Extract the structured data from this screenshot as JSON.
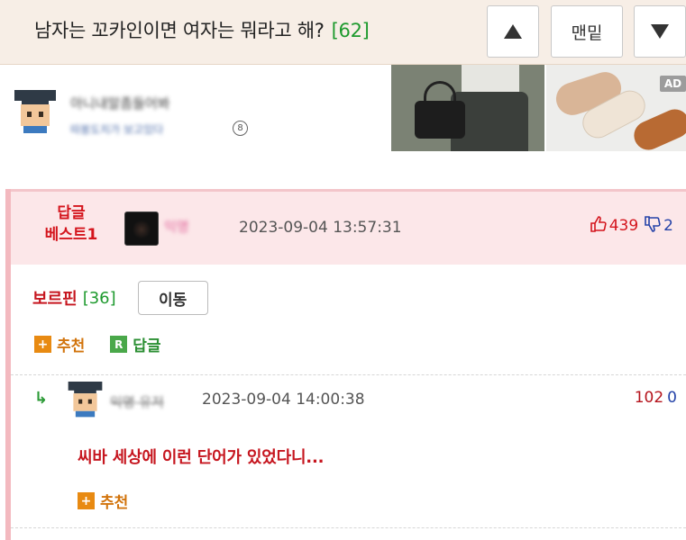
{
  "topbar": {
    "title": "남자는 꼬카인이면 여자는 뭐라고 해?",
    "comment_count": "[62]",
    "bottom_label": "맨밑"
  },
  "author": {
    "name_blurred": "아니내말좀들어봐",
    "sub_blurred": "따봉도치가 보고있다",
    "badge": "8"
  },
  "ad": {
    "tag": "AD"
  },
  "best_comment": {
    "label_line1": "답글",
    "label_line2": "베스트1",
    "nick_blurred": "익명",
    "date": "2023-09-04 13:57:31",
    "up": "439",
    "down": "2",
    "text": "보르핀",
    "count": "[36]",
    "move_label": "이동",
    "recommend_label": "추천",
    "reply_icon": "R",
    "reply_label": "답글"
  },
  "reply": {
    "arrow": "↳",
    "nick_blurred": "익명 유저",
    "date": "2023-09-04 14:00:38",
    "up": "102",
    "down": "0",
    "text": "씨바 세상에 이런 단어가 있었다니...",
    "recommend_label": "추천"
  },
  "colors": {
    "accent_red": "#d4151d",
    "count_green": "#1e9a2e",
    "recommend_orange": "#d2740d",
    "vote_blue": "#2442a8",
    "best_bg": "#fce7e9"
  }
}
